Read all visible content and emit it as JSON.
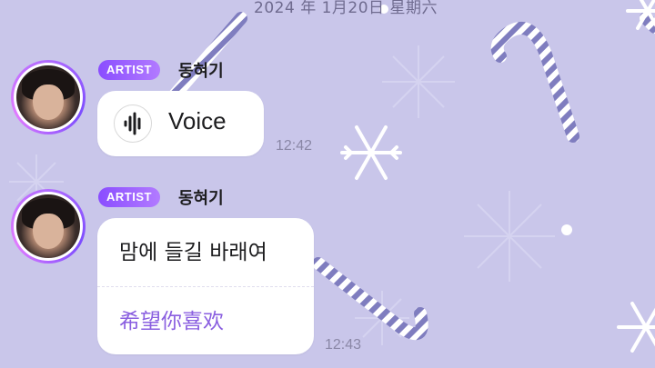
{
  "header": {
    "date": "2024 年 1月20日 星期六"
  },
  "messages": [
    {
      "badge": "ARTIST",
      "sender": "동혀기",
      "voice_label": "Voice",
      "time": "12:42"
    },
    {
      "badge": "ARTIST",
      "sender": "동혀기",
      "text": "맘에 들길 바래여",
      "translation": "希望你喜欢",
      "time": "12:43"
    }
  ],
  "colors": {
    "background": "#c9c6ea",
    "badge": "#8a4dff",
    "translation": "#8a5fe0",
    "candy_cane": "#7f7dbf"
  },
  "icons": [
    "voice-waveform-icon",
    "snowflake-icon",
    "candy-cane-icon"
  ]
}
